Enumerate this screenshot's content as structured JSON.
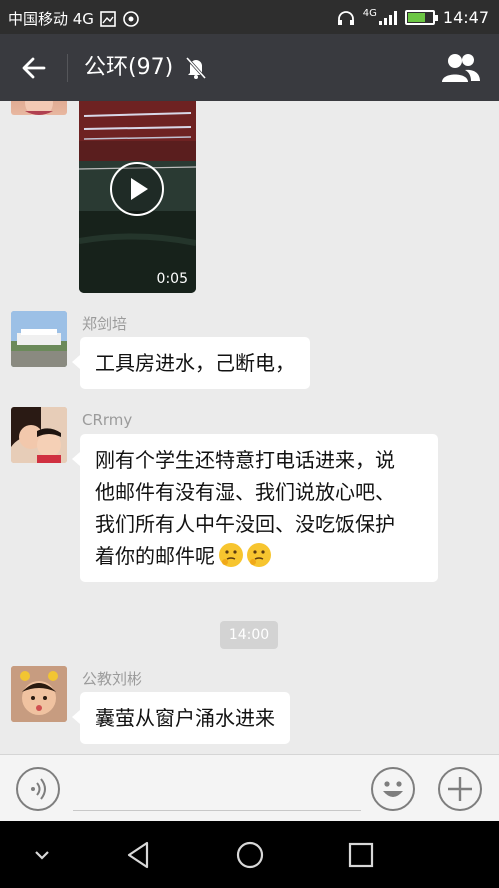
{
  "status_bar": {
    "carrier": "中国移动 4G",
    "network": "4G",
    "time": "14:47",
    "battery_level": 0.7
  },
  "header": {
    "title": "公环(97)",
    "back_icon": "arrow-left-icon",
    "mute_icon": "bell-off-icon",
    "group_icon": "group-members-icon"
  },
  "chat": {
    "video": {
      "duration": "0:05"
    },
    "messages": [
      {
        "sender": "郑剑培",
        "text": "工具房进水，己断电，"
      },
      {
        "sender": "CRrmy",
        "lines": [
          "刚有个学生还特意打电话进来，说",
          "他邮件有没有湿、我们说放心吧、",
          "我们所有人中午没回、没吃饭保护",
          "着你的邮件呢"
        ]
      },
      {
        "sender": "公教刘彬",
        "text": "囊萤从窗户涌水进来"
      }
    ],
    "time_divider": "14:00"
  },
  "input_bar": {
    "voice_icon": "voice-icon",
    "emoji_icon": "smiley-icon",
    "plus_icon": "plus-icon"
  },
  "nav_bar": {
    "icons": [
      "chevron-down-icon",
      "back-triangle-icon",
      "home-circle-icon",
      "recents-square-icon"
    ]
  },
  "colors": {
    "titlebar": "#393a3f",
    "statusbar": "#2e2e2e",
    "chat_bg": "#ebebeb",
    "bubble": "#ffffff"
  }
}
